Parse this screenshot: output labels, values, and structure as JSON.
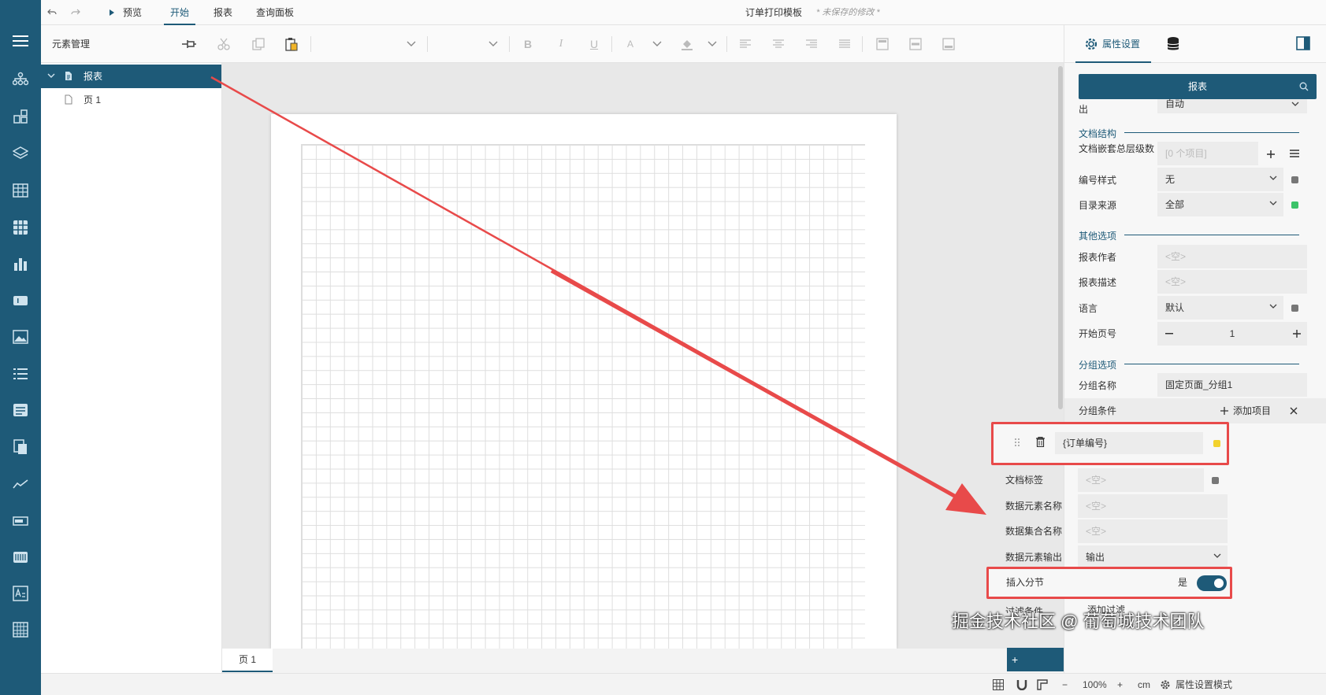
{
  "topmenu": {
    "undo_icon": "undo-icon",
    "redo_icon": "redo-icon",
    "preview_label": "预览",
    "tab_start": "开始",
    "tab_report": "报表",
    "tab_query": "查询面板",
    "doc_title": "订单打印模板",
    "unsaved": "* 未保存的修改 *"
  },
  "outline": {
    "title": "元素管理",
    "root_label": "报表",
    "child_label": "页 1"
  },
  "pagetabs": {
    "tab1": "页 1",
    "add_label": "+"
  },
  "rpanel": {
    "tab_property": "属性设置",
    "search_label": "报表",
    "row_top_label": "出",
    "row_top_value": "自动",
    "sec_doc_structure": "文档结构",
    "nest_label": "文档嵌套总层级数",
    "nest_value": "[0 个项目]",
    "numbering_label": "编号样式",
    "numbering_value": "无",
    "toc_label": "目录来源",
    "toc_value": "全部",
    "sec_other": "其他选项",
    "author_label": "报表作者",
    "author_placeholder": "<空>",
    "desc_label": "报表描述",
    "desc_placeholder": "<空>",
    "lang_label": "语言",
    "lang_value": "默认",
    "startpage_label": "开始页号",
    "startpage_value": "1",
    "sec_group": "分组选项",
    "groupname_label": "分组名称",
    "groupname_value": "固定页面_分组1",
    "groupcond_label": "分组条件",
    "add_item_label": "添加项目",
    "group_item_value": "{订单编号}",
    "doctag_label": "文档标签",
    "doctag_placeholder": "<空>",
    "dataelem_label": "数据元素名称",
    "dataelem_placeholder": "<空>",
    "dataset_label": "数据集合名称",
    "dataset_placeholder": "<空>",
    "dataout_label": "数据元素输出",
    "dataout_value": "输出",
    "insert_label": "插入分节",
    "insert_value": "是",
    "filter_label": "过滤条件",
    "add_filter_label": "添加过滤"
  },
  "status": {
    "zoom": "100%",
    "unit": "cm",
    "mode": "属性设置模式"
  },
  "watermark": "掘金技术社区 @ 葡萄城技术团队",
  "colors": {
    "accent": "#1e5a78",
    "highlight": "#e84a4a",
    "green_dot": "#3cc36a",
    "yellow_dot": "#f2d22e"
  }
}
